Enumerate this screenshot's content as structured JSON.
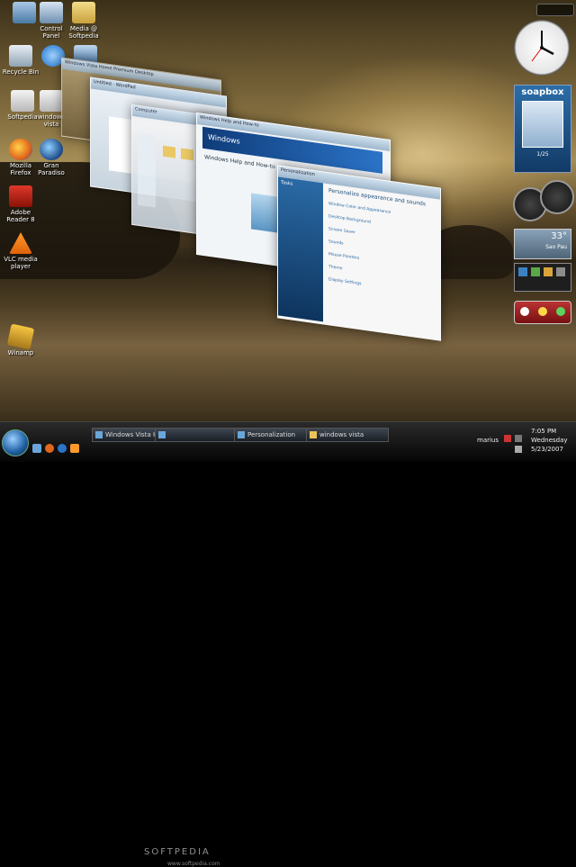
{
  "desktop": {
    "icons": [
      {
        "label": "",
        "icon": "computer-icon"
      },
      {
        "label": "Control Panel",
        "icon": "control-panel-icon"
      },
      {
        "label": "Media @ Softpedia",
        "icon": "folder-icon"
      },
      {
        "label": "Recycle Bin",
        "icon": "recycle-bin-icon"
      },
      {
        "label": "",
        "icon": "ie-icon"
      },
      {
        "label": "",
        "icon": "network-icon"
      },
      {
        "label": "Softpedia",
        "icon": "document-icon"
      },
      {
        "label": "windows vista",
        "icon": "document-icon"
      },
      {
        "label": "Mozilla Firefox",
        "icon": "firefox-icon"
      },
      {
        "label": "Gran Paradiso",
        "icon": "gran-paradiso-icon"
      },
      {
        "label": "Adobe Reader 8",
        "icon": "adobe-reader-icon"
      },
      {
        "label": "VLC media player",
        "icon": "vlc-icon"
      },
      {
        "label": "Winamp",
        "icon": "winamp-icon"
      }
    ]
  },
  "flip3d": {
    "windows": [
      {
        "title": "Windows Vista Home Premium Desktop"
      },
      {
        "title": "Untitled - WordPad"
      },
      {
        "title": "Computer"
      },
      {
        "title": "Windows Help and How-to"
      },
      {
        "title": "Personalization"
      }
    ],
    "help_heading": "Windows Help and How-to",
    "help_banner": "Windows",
    "personalization_heading": "Personalize appearance and sounds",
    "personalization_items": [
      "Window Color and Appearance",
      "Desktop Background",
      "Screen Saver",
      "Sounds",
      "Mouse Pointers",
      "Theme",
      "Display Settings"
    ],
    "tasks_heading": "Tasks"
  },
  "gadgets": {
    "soapbox_title": "soapbox",
    "soapbox_page": "1/25",
    "weather_temp": "33°",
    "weather_city": "Sao Pau",
    "clock_time": "7:05"
  },
  "taskbar": {
    "tasks": [
      {
        "label": "Windows Vista Ho...",
        "icon": "window-icon"
      },
      {
        "label": "",
        "icon": "window-icon"
      },
      {
        "label": "Personalization",
        "icon": "personalization-icon"
      },
      {
        "label": "windows vista",
        "icon": "folder-icon"
      }
    ],
    "user": "marius",
    "time": "7:05 PM",
    "day": "Wednesday",
    "date": "5/23/2007",
    "watermark": "SOFTPEDIA",
    "watermark_url": "www.softpedia.com"
  },
  "colors": {
    "accent": "#3a7bd5",
    "taskbar_bg": "#0b0b0b"
  }
}
